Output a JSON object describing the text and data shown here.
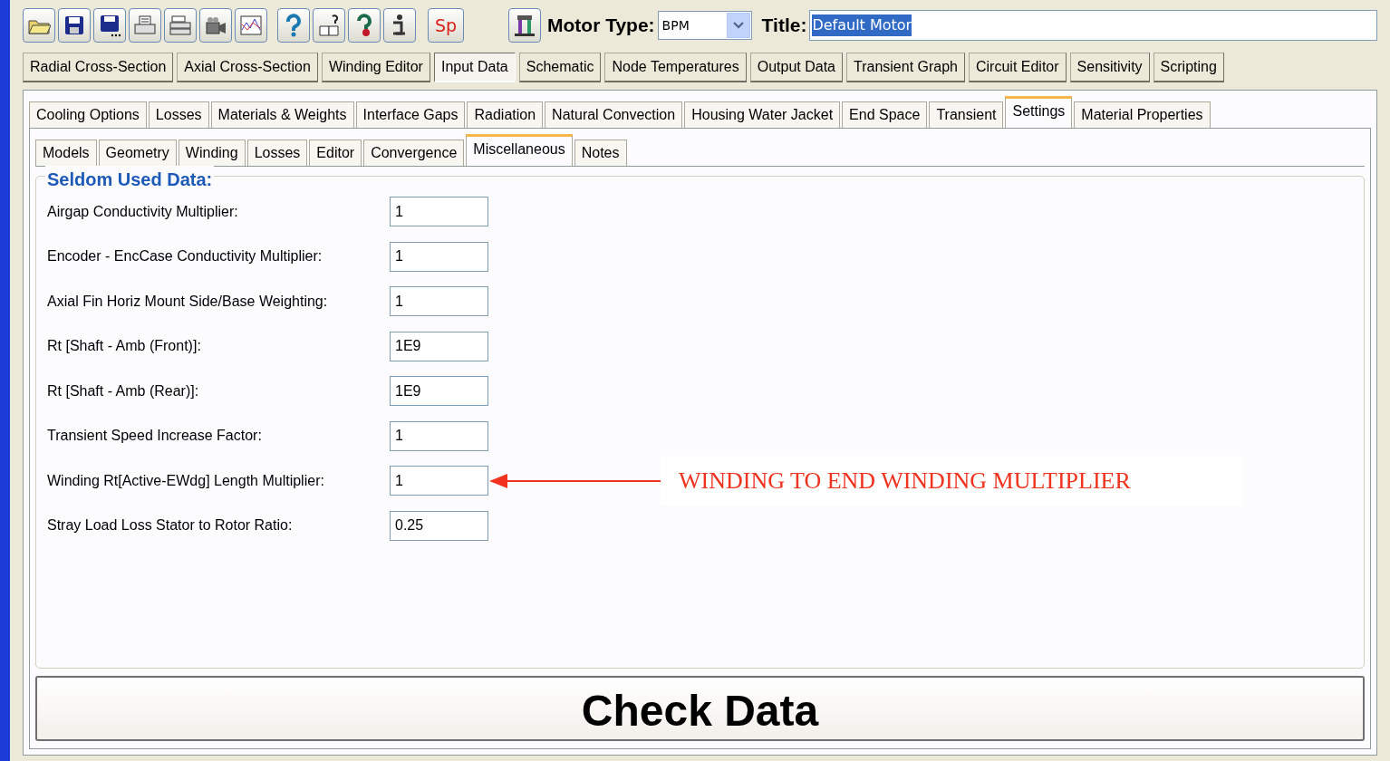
{
  "toolbar": {
    "sp_button": "Sp",
    "motor_type": {
      "label": "Motor Type:",
      "value": "BPM"
    },
    "title": {
      "label": "Title:",
      "value": "Default Motor"
    }
  },
  "main_tabs": [
    {
      "label": "Radial Cross-Section",
      "selected": false
    },
    {
      "label": "Axial Cross-Section",
      "selected": false
    },
    {
      "label": "Winding Editor",
      "selected": false
    },
    {
      "label": "Input Data",
      "selected": true
    },
    {
      "label": "Schematic",
      "selected": false
    },
    {
      "label": "Node Temperatures",
      "selected": false
    },
    {
      "label": "Output Data",
      "selected": false
    },
    {
      "label": "Transient Graph",
      "selected": false
    },
    {
      "label": "Circuit Editor",
      "selected": false
    },
    {
      "label": "Sensitivity",
      "selected": false
    },
    {
      "label": "Scripting",
      "selected": false
    }
  ],
  "input_tabs": [
    {
      "label": "Cooling Options",
      "selected": false
    },
    {
      "label": "Losses",
      "selected": false
    },
    {
      "label": "Materials & Weights",
      "selected": false
    },
    {
      "label": "Interface Gaps",
      "selected": false
    },
    {
      "label": "Radiation",
      "selected": false
    },
    {
      "label": "Natural Convection",
      "selected": false
    },
    {
      "label": "Housing Water Jacket",
      "selected": false
    },
    {
      "label": "End Space",
      "selected": false
    },
    {
      "label": "Transient",
      "selected": false
    },
    {
      "label": "Settings",
      "selected": true
    },
    {
      "label": "Material Properties",
      "selected": false
    }
  ],
  "settings_tabs": [
    {
      "label": "Models",
      "selected": false
    },
    {
      "label": "Geometry",
      "selected": false
    },
    {
      "label": "Winding",
      "selected": false
    },
    {
      "label": "Losses",
      "selected": false
    },
    {
      "label": "Editor",
      "selected": false
    },
    {
      "label": "Convergence",
      "selected": false
    },
    {
      "label": "Miscellaneous",
      "selected": true
    },
    {
      "label": "Notes",
      "selected": false
    }
  ],
  "group": {
    "title": "Seldom Used Data:",
    "fields": [
      {
        "label": "Airgap Conductivity Multiplier:",
        "value": "1"
      },
      {
        "label": "Encoder - EncCase Conductivity Multiplier:",
        "value": "1"
      },
      {
        "label": "Axial Fin Horiz Mount Side/Base Weighting:",
        "value": "1"
      },
      {
        "label": "Rt [Shaft - Amb (Front)]:",
        "value": "1E9"
      },
      {
        "label": "Rt [Shaft - Amb (Rear)]:",
        "value": "1E9"
      },
      {
        "label": "Transient Speed Increase Factor:",
        "value": "1"
      },
      {
        "label": "Winding Rt[Active-EWdg] Length Multiplier:",
        "value": "1",
        "annotated": true
      },
      {
        "label": "Stray Load Loss Stator to Rotor Ratio:",
        "value": "0.25",
        "annotated": false
      }
    ]
  },
  "annotation": "WINDING TO END WINDING MULTIPLIER",
  "check_button": "Check Data"
}
